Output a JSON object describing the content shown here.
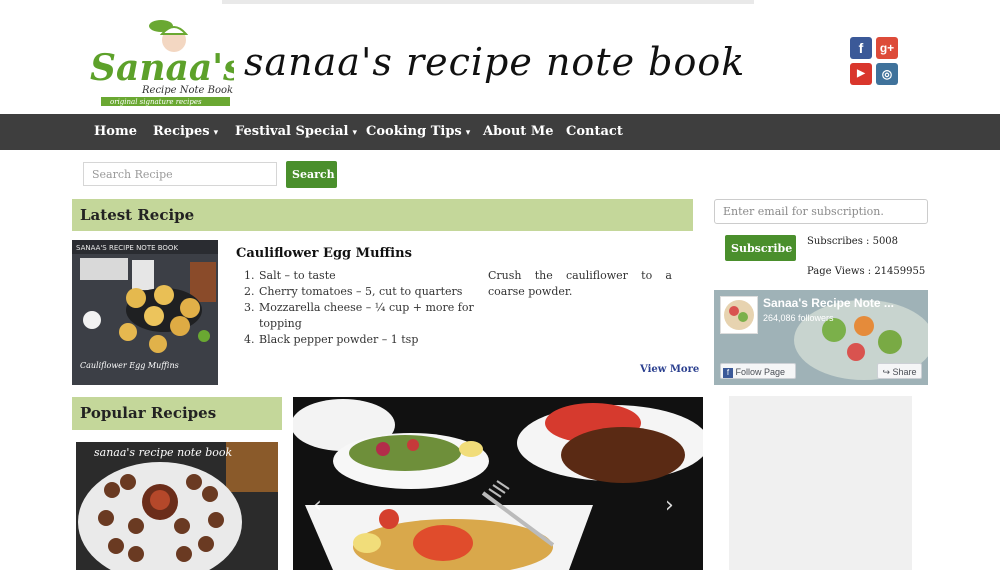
{
  "header": {
    "logo_text": "Sanaa's",
    "logo_subtext": "Recipe Note Book",
    "logo_tagline": "original signature recipes",
    "site_title": "sanaa's recipe note book"
  },
  "social": {
    "facebook": "f",
    "googleplus": "g+",
    "youtube": "▶",
    "instagram": "◎"
  },
  "nav": {
    "items": [
      {
        "label": "Home",
        "dropdown": false
      },
      {
        "label": "Recipes",
        "dropdown": true
      },
      {
        "label": "Festival Special",
        "dropdown": true
      },
      {
        "label": "Cooking Tips",
        "dropdown": true
      },
      {
        "label": "About Me",
        "dropdown": false
      },
      {
        "label": "Contact",
        "dropdown": false
      }
    ],
    "caret": "▾"
  },
  "search": {
    "placeholder": "Search Recipe",
    "button": "Search"
  },
  "latest": {
    "heading": "Latest Recipe",
    "image_banner": "SANAA'S RECIPE NOTE BOOK",
    "image_caption": "Cauliflower Egg Muffins",
    "title": "Cauliflower Egg Muffins",
    "ingredients": [
      "Salt – to taste",
      "Cherry tomatoes – 5, cut to quarters",
      "Mozzarella cheese – ¼ cup + more for topping",
      "Black pepper powder – 1 tsp"
    ],
    "method": "Crush the cauliflower to a coarse powder.",
    "view_more": "View More"
  },
  "sidebar": {
    "email_placeholder": "Enter email for subscription.",
    "subscribe_button": "Subscribe",
    "subscribers": "Subscribes : 5008",
    "page_views": "Page Views : 21459955",
    "fb": {
      "name": "Sanaa's Recipe Note ...",
      "followers": "264,086 followers",
      "follow_label": "Follow Page",
      "share_label": "Share"
    }
  },
  "popular": {
    "heading": "Popular Recipes",
    "image_caption": "sanaa's recipe note book"
  },
  "slider": {
    "prev": "‹",
    "next": "›"
  },
  "colors": {
    "nav_bg": "#3e3e3e",
    "section_header_bg": "#c4d79a",
    "button_green": "#4a8f2c",
    "link_blue": "#2a3f8f"
  }
}
